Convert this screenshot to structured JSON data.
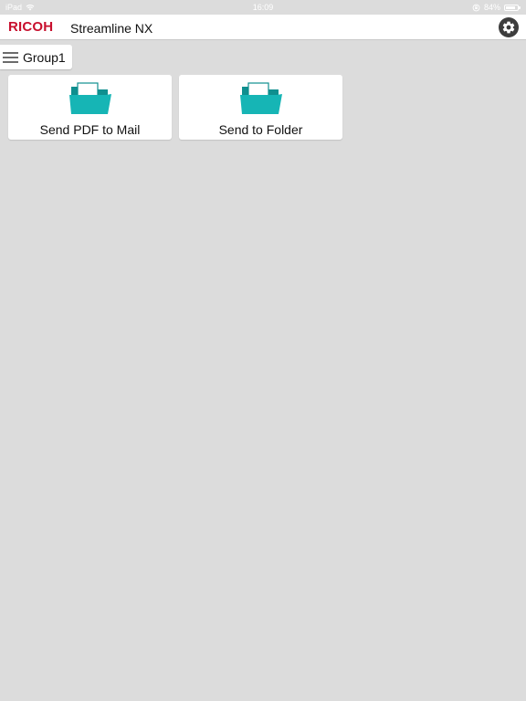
{
  "status_bar": {
    "carrier": "iPad",
    "time": "16:09",
    "battery_text": "84%",
    "battery_level": 0.84
  },
  "header": {
    "brand": "RICOH",
    "app_title": "Streamline NX",
    "brand_color": "#c8102e",
    "settings_icon": "gear-icon"
  },
  "group": {
    "label": "Group1",
    "menu_icon": "hamburger-menu-icon"
  },
  "tiles": [
    {
      "label": "Send PDF to Mail",
      "icon": "folder-icon",
      "icon_color": "#14b3b3"
    },
    {
      "label": "Send to Folder",
      "icon": "folder-icon",
      "icon_color": "#14b3b3"
    }
  ]
}
